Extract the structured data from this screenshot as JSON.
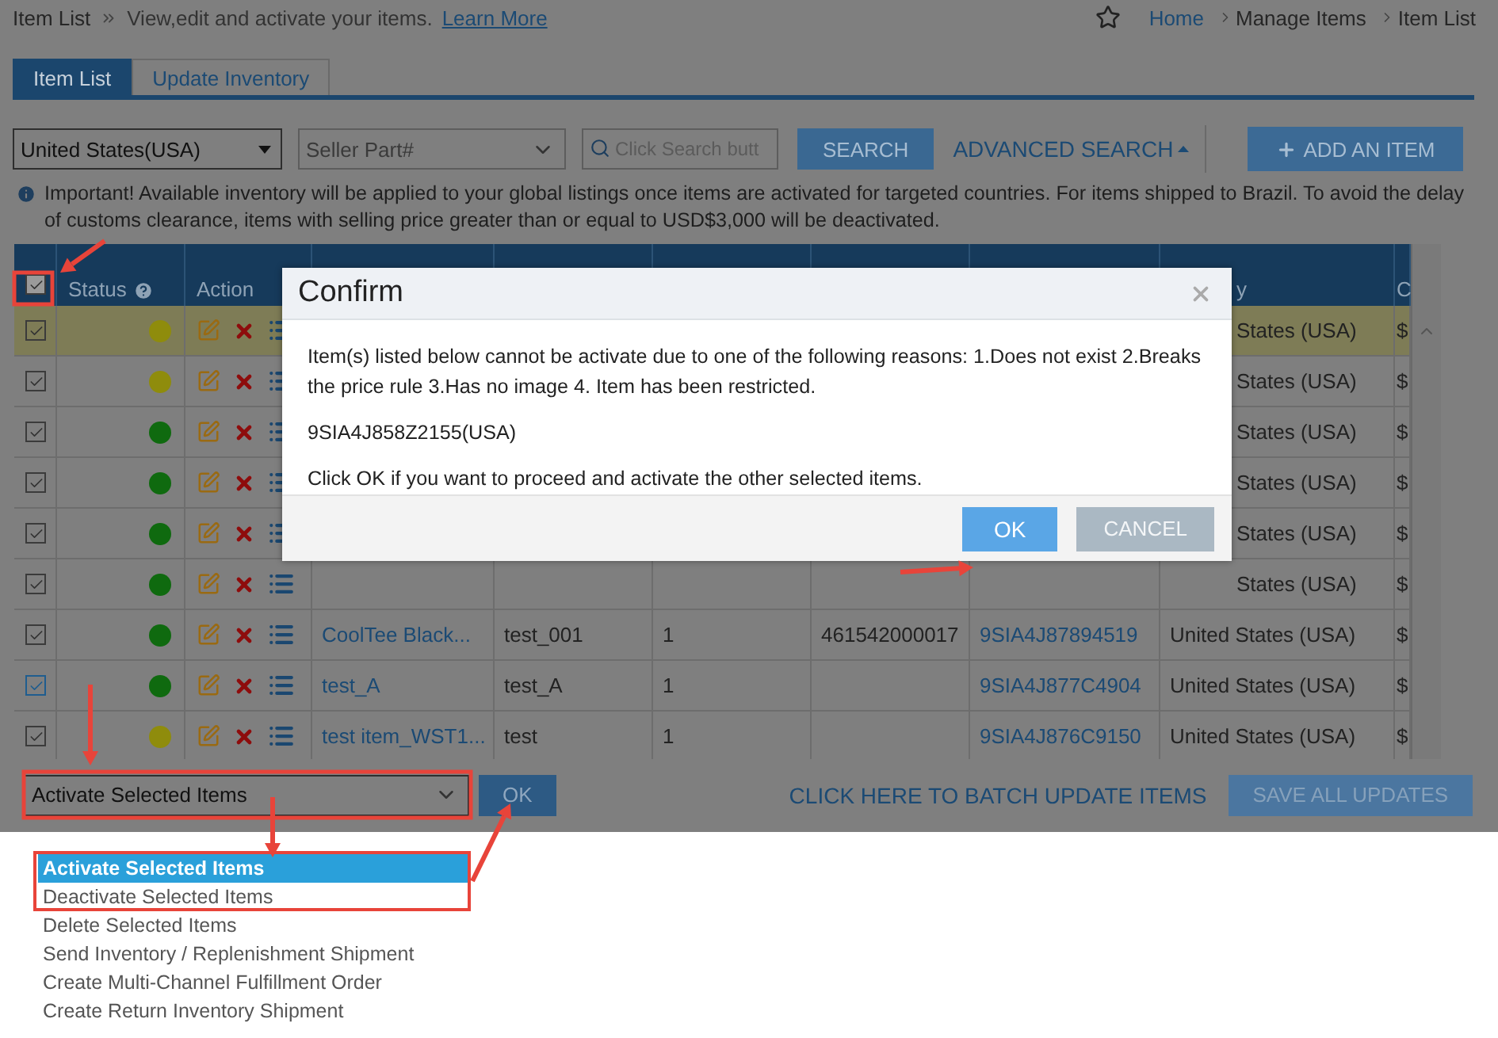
{
  "header": {
    "title": "Item List",
    "description": "View,edit and activate your items.",
    "link": "Learn More"
  },
  "breadcrumb": [
    {
      "label": "Home",
      "link": true
    },
    {
      "label": "Manage Items",
      "link": false
    },
    {
      "label": "Item List",
      "link": false
    }
  ],
  "tabs": [
    {
      "label": "Item List",
      "selected": true
    },
    {
      "label": "Update Inventory",
      "selected": false
    }
  ],
  "filters": {
    "country": "United States(USA)",
    "field": "Seller Part#",
    "search_placeholder": "Click Search butt",
    "search_button": "SEARCH",
    "advanced_search": "ADVANCED SEARCH",
    "add_button": "ADD AN ITEM"
  },
  "notice": "Important! Available inventory will be applied to your global listings once items are activated for targeted countries. For items shipped to Brazil. To avoid the delay of customs clearance, items with selling price greater than or equal to USD$3,000 will be deactivated.",
  "table": {
    "header_checked": true,
    "columns": [
      "Status",
      "Action",
      "y",
      "C"
    ],
    "rows": [
      {
        "checked": true,
        "focused": false,
        "highlighted": true,
        "covered": true,
        "color": "#8f8c0c",
        "country": "States (USA)",
        "price": "$"
      },
      {
        "checked": true,
        "focused": false,
        "highlighted": false,
        "covered": true,
        "color": "#8f8c0c",
        "country": "States (USA)",
        "price": "$"
      },
      {
        "checked": true,
        "focused": false,
        "highlighted": false,
        "covered": true,
        "color": "#0f6a0f",
        "country": "States (USA)",
        "price": "$"
      },
      {
        "checked": true,
        "focused": false,
        "highlighted": false,
        "covered": true,
        "color": "#0f6a0f",
        "country": "States (USA)",
        "price": "$"
      },
      {
        "checked": true,
        "focused": false,
        "highlighted": false,
        "covered": true,
        "color": "#0f6a0f",
        "country": "States (USA)",
        "price": "$"
      },
      {
        "checked": true,
        "focused": false,
        "highlighted": false,
        "covered": true,
        "color": "#0f6a0f",
        "country": "States (USA)",
        "price": "$"
      },
      {
        "checked": true,
        "focused": false,
        "highlighted": false,
        "covered": false,
        "color": "#0f6a0f",
        "name": "CoolTee Black...",
        "sku": "test_001",
        "qty": "1",
        "upc": "461542000017",
        "item_number": "9SIA4J87894519",
        "country": "United States (USA)",
        "price": "$"
      },
      {
        "checked": true,
        "focused": true,
        "highlighted": false,
        "covered": false,
        "color": "#0f6a0f",
        "name": "test_A",
        "sku": "test_A",
        "qty": "1",
        "item_number": "9SIA4J877C4904",
        "country": "United States (USA)",
        "price": "$"
      },
      {
        "checked": true,
        "focused": false,
        "highlighted": false,
        "covered": false,
        "color": "#8f8c0c",
        "name": "test item_WST1...",
        "sku": "test",
        "qty": "1",
        "item_number": "9SIA4J876C9150",
        "country": "United States (USA)",
        "price": "$"
      }
    ]
  },
  "bulk": {
    "action": "Activate Selected Items",
    "ok": "OK",
    "batch_link": "CLICK HERE TO BATCH UPDATE ITEMS",
    "save": "SAVE ALL UPDATES",
    "save_disabled": true
  },
  "action_options": [
    {
      "label": "Activate Selected Items",
      "selected": true
    },
    {
      "label": "Deactivate Selected Items",
      "selected": false
    },
    {
      "label": "Delete Selected Items",
      "selected": false
    },
    {
      "label": "Send Inventory / Replenishment Shipment",
      "selected": false
    },
    {
      "label": "Create Multi-Channel Fulfillment Order",
      "selected": false
    },
    {
      "label": "Create Return Inventory Shipment",
      "selected": false
    }
  ],
  "dialog": {
    "title": "Confirm",
    "message": "Item(s) listed below cannot be activate due to one of the following reasons: 1.Does not exist 2.Breaks the price rule 3.Has no image 4. Item has been restricted.",
    "item": "9SIA4J858Z2155(USA)",
    "prompt": "Click OK if you want to proceed and activate the other selected items.",
    "ok": "OK",
    "cancel": "CANCEL"
  }
}
